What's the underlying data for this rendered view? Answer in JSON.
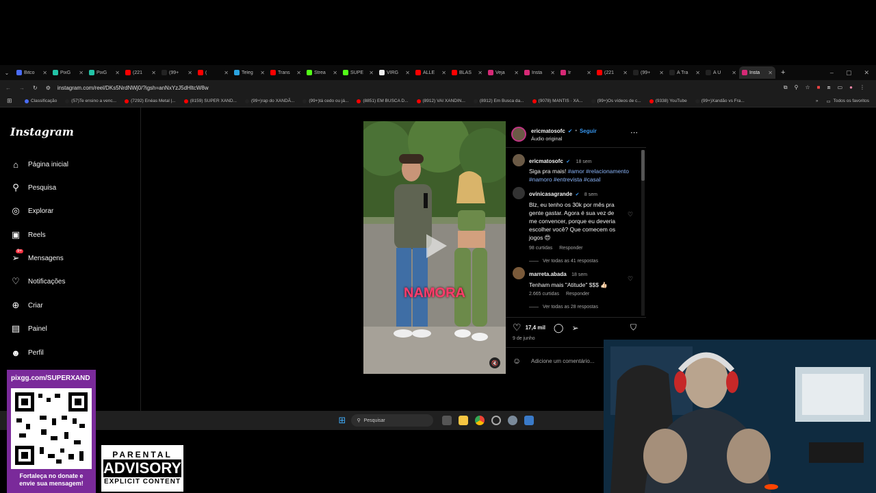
{
  "tabs": [
    {
      "title": "Bitco",
      "color": "#4a6cf7"
    },
    {
      "title": "PixG",
      "color": "#22c3a6"
    },
    {
      "title": "PixG",
      "color": "#22c3a6"
    },
    {
      "title": "(221",
      "color": "#ff0000"
    },
    {
      "title": "(99+",
      "color": "#222222"
    },
    {
      "title": "(",
      "color": "#ff0000"
    },
    {
      "title": "Teleg",
      "color": "#2aa3e0"
    },
    {
      "title": "Trans",
      "color": "#ff0000"
    },
    {
      "title": "Strea",
      "color": "#53fc18"
    },
    {
      "title": "SUPE",
      "color": "#53fc18"
    },
    {
      "title": "VIRG",
      "color": "#eeeeee"
    },
    {
      "title": "ALLE",
      "color": "#ff0000"
    },
    {
      "title": "BLAS",
      "color": "#ff0000"
    },
    {
      "title": "Veja",
      "color": "#d62976"
    },
    {
      "title": "Insta",
      "color": "#d62976"
    },
    {
      "title": "Ir",
      "color": "#d62976"
    },
    {
      "title": "(221",
      "color": "#ff0000"
    },
    {
      "title": "(99+",
      "color": "#222222"
    },
    {
      "title": "A Tra",
      "color": "#222222"
    },
    {
      "title": "A Ú",
      "color": "#222222"
    },
    {
      "title": "Insta",
      "color": "#d62976",
      "active": true
    }
  ],
  "address": {
    "url": "instagram.com/reel/DKs5NrdNWj0/?igsh=anNxYzJ5dHltcW8w"
  },
  "bookmarks": [
    {
      "label": "Classificação",
      "color": "#4a6cf7"
    },
    {
      "label": "(57)Te ensino a venc...",
      "color": "#222222"
    },
    {
      "label": "(7292) Enéas Metal |...",
      "color": "#ff0000"
    },
    {
      "label": "(8159) SUPER XAND...",
      "color": "#ff0000"
    },
    {
      "label": "(99+)rap do XANDÃ...",
      "color": "#222222"
    },
    {
      "label": "(99+)tá cedo ou já...",
      "color": "#222222"
    },
    {
      "label": "(8851) EM BUSCA D...",
      "color": "#ff0000"
    },
    {
      "label": "(8912) VAI XANDIN...",
      "color": "#ff0000"
    },
    {
      "label": "(8912) Em Busca da...",
      "color": "#222222"
    },
    {
      "label": "(9078) MANTIS · XA...",
      "color": "#ff0000"
    },
    {
      "label": "(99+)Os vídeos de c...",
      "color": "#222222"
    },
    {
      "label": "(9338) YouTube",
      "color": "#ff0000"
    },
    {
      "label": "(99+)Xandão vs Fra...",
      "color": "#222222"
    }
  ],
  "bookmarks_all": "Todos os favoritos",
  "instagram": {
    "logo": "Instagram",
    "nav": [
      {
        "label": "Página inicial",
        "icon": "home-icon",
        "glyph": "⌂"
      },
      {
        "label": "Pesquisa",
        "icon": "search-icon",
        "glyph": "⚲"
      },
      {
        "label": "Explorar",
        "icon": "compass-icon",
        "glyph": "◎"
      },
      {
        "label": "Reels",
        "icon": "reels-icon",
        "glyph": "▣"
      },
      {
        "label": "Mensagens",
        "icon": "messages-icon",
        "glyph": "➢",
        "badge": "9+"
      },
      {
        "label": "Notificações",
        "icon": "heart-icon",
        "glyph": "♡"
      },
      {
        "label": "Criar",
        "icon": "plus-icon",
        "glyph": "⊕"
      },
      {
        "label": "Painel",
        "icon": "dashboard-icon",
        "glyph": "▤"
      },
      {
        "label": "Perfil",
        "icon": "profile-icon",
        "glyph": "☻"
      }
    ]
  },
  "reel": {
    "overlay_text": "NAMORA"
  },
  "post": {
    "author": "ericmatosofc",
    "follow": "Seguir",
    "audio": "Áudio original",
    "caption_author": "ericmatosofc",
    "caption_time": "18 sem",
    "caption_text": "Siga pra mais!",
    "caption_tags": "#amor #relacionamento #namoro #entrevista #casal",
    "comments": [
      {
        "user": "ovinicasagrande",
        "time": "8 sem",
        "text": "Blz, eu tenho os 30k por mês pra gente gastar. Agora é sua vez de me convencer, porque eu deveria escolher você? Que comecem os jogos 😍",
        "likes": "98 curtidas",
        "reply": "Responder",
        "view": "Ver todas as 41 respostas"
      },
      {
        "user": "marreta.abada",
        "time": "18 sem",
        "text": "Tenham mais \"Atitude\" $$$ 👍🏻",
        "likes": "2.665 curtidas",
        "reply": "Responder",
        "view": "Ver todas as 28 respostas"
      }
    ],
    "like_count": "17,4 mil",
    "date": "9 de junho",
    "comment_placeholder": "Adicione um comentário..."
  },
  "taskbar": {
    "search": "Pesquisar"
  },
  "overlay": {
    "pix_url": "pixgg.com/SUPERXAND",
    "pix_text": "Fortaleça no donate e envie sua mensagem!",
    "advisory_1": "PARENTAL",
    "advisory_2": "ADVISORY",
    "advisory_3": "EXPLICIT CONTENT"
  }
}
